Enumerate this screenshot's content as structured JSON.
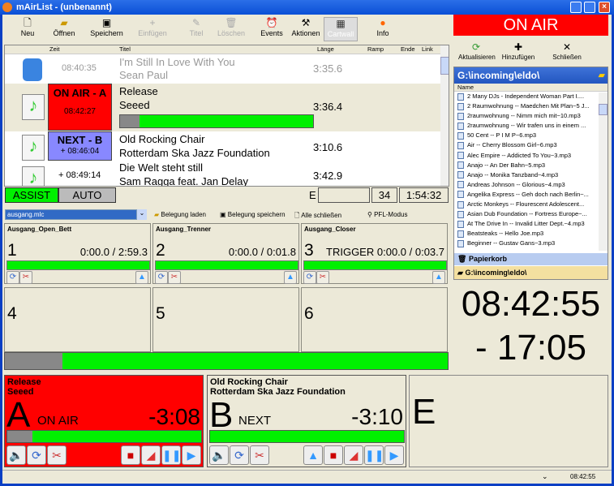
{
  "window": {
    "title": "mAirList - (unbenannt)"
  },
  "toolbar": {
    "items": [
      {
        "label": "Neu",
        "icon": "new-file-icon"
      },
      {
        "label": "Öffnen",
        "icon": "open-folder-icon"
      },
      {
        "label": "Speichern",
        "icon": "save-icon"
      },
      {
        "label": "Einfügen",
        "icon": "plus-icon"
      },
      {
        "label": "Titel",
        "icon": "title-icon"
      },
      {
        "label": "Löschen",
        "icon": "trash-icon"
      },
      {
        "label": "Events",
        "icon": "events-icon"
      },
      {
        "label": "Aktionen",
        "icon": "actions-icon"
      },
      {
        "label": "Cartwall",
        "icon": "cartwall-icon"
      },
      {
        "label": "Info",
        "icon": "info-icon"
      }
    ]
  },
  "onair_label": "ON AIR",
  "browser_toolbar": {
    "refresh": "Aktualisieren",
    "add": "Hinzufügen",
    "close": "Schließen"
  },
  "playlist": {
    "headers": [
      "Zeit",
      "Titel",
      "Länge",
      "Ramp",
      "Ende",
      "Link"
    ],
    "rows": [
      {
        "time": "08:40:35",
        "title": "I'm Still In Love With You",
        "artist": "Sean Paul",
        "length": "3:35.6"
      },
      {
        "status": "ON AIR - A",
        "time": "08:42:27",
        "title": "Release",
        "artist": "Seeed",
        "length": "3:36.4",
        "progress": 0.1
      },
      {
        "status": "NEXT - B",
        "time": "+ 08:46:04",
        "title": "Old Rocking Chair",
        "artist": "Rotterdam Ska Jazz Foundation",
        "length": "3:10.6"
      },
      {
        "time": "+ 08:49:14",
        "title": "Die Welt steht still",
        "artist": "Sam Ragga feat. Jan Delay",
        "length": "3:42.9"
      }
    ]
  },
  "modes": {
    "assist": "ASSIST",
    "auto": "AUTO",
    "e": "E",
    "count": "34",
    "total": "1:54:32"
  },
  "cartwall": {
    "file": "ausgang.mlc",
    "load": "Belegung laden",
    "save": "Belegung speichern",
    "close_all": "Alle schließen",
    "pfl": "PFL-Modus",
    "carts": [
      {
        "num": "1",
        "name": "Ausgang_Open_Bett",
        "time": "0:00.0 / 2:59.3",
        "trigger": ""
      },
      {
        "num": "2",
        "name": "Ausgang_Trenner",
        "time": "0:00.0 / 0:01.8",
        "trigger": ""
      },
      {
        "num": "3",
        "name": "Ausgang_Closer",
        "time": "0:00.0 / 0:03.7",
        "trigger": "TRIGGER"
      },
      {
        "num": "4"
      },
      {
        "num": "5"
      },
      {
        "num": "6"
      }
    ],
    "progress": 0.13
  },
  "browser": {
    "path": "G:\\incoming\\eldo\\",
    "column": "Name",
    "files": [
      "2 Many DJs - Independent Woman Part I....",
      "2 Raumwohnung -- Maedchen Mit Plan~5 J...",
      "2raumwohnung -- Nimm mich mit~10.mp3",
      "2raumwohnung -- Wir trafen uns in einem ...",
      "50 Cent -- P I M P~6.mp3",
      "Air -- Cherry Blossom Girl~6.mp3",
      "Alec Empire -- Addicted To You~3.mp3",
      "Anajo -- An Der Bahn~5.mp3",
      "Anajo -- Monika Tanzband~4.mp3",
      "Andreas Johnson -- Glorious~4.mp3",
      "Angelika Express -- Geh doch nach Berlin~...",
      "Arctic Monkeys -- Flourescent Adolescent...",
      "Asian Dub Foundation -- Fortress Europe~...",
      "At The Drive In -- Invalid Litter Dept.~4.mp3",
      "Beatsteaks -- Hello Joe.mp3",
      "Beginner -- Gustav Gans~3.mp3"
    ],
    "trash": "Papierkorb",
    "folder": "G:\\incoming\\eldo\\"
  },
  "clock": {
    "time": "08:42:55",
    "remaining": "- 17:05"
  },
  "players": [
    {
      "letter": "A",
      "title": "Release",
      "artist": "Seeed",
      "state": "ON AIR",
      "remaining": "-3:08",
      "progress": 0.13,
      "color": "#ff0000"
    },
    {
      "letter": "B",
      "title": "Old Rocking Chair",
      "artist": "Rotterdam Ska Jazz Foundation",
      "state": "NEXT",
      "remaining": "-3:10",
      "progress": 0.0,
      "color": "#ece9d8"
    },
    {
      "letter": "E"
    }
  ],
  "statusbar": {
    "time": "08:42:55"
  },
  "colors": {
    "onair": "#ff0000",
    "next": "#8888ff",
    "green": "#00f000"
  }
}
